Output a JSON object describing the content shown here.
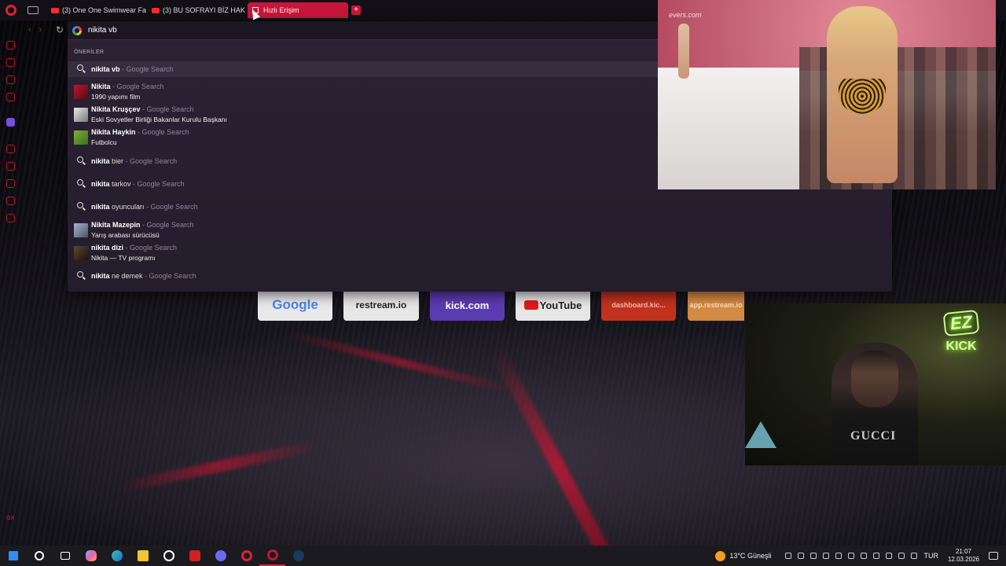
{
  "tabs": [
    {
      "label": "(3) One One Swimwear Fa",
      "type": "youtube"
    },
    {
      "label": "(3) BU SOFRAYI BİZ HAK",
      "type": "youtube"
    },
    {
      "label": "Hızlı Erişim",
      "type": "speed-dial",
      "active": true
    }
  ],
  "address": {
    "value": "nikita vb"
  },
  "suggestions_header": "ÖNERİLER",
  "suggestions": [
    {
      "bold": "nikita vb",
      "rest": "",
      "source": "- Google Search",
      "sub": "",
      "icon": "search-icon"
    },
    {
      "bold": "Nikita",
      "rest": "",
      "source": "- Google Search",
      "sub": "1990 yapımı film",
      "icon": "thumbnail"
    },
    {
      "bold": "Nikita Kruşçev",
      "rest": "",
      "source": "- Google Search",
      "sub": "Eski Sovyetler Birliği Bakanlar Kurulu Başkanı",
      "icon": "thumbnail"
    },
    {
      "bold": "Nikita Haykin",
      "rest": "",
      "source": "- Google Search",
      "sub": "Futbolcu",
      "icon": "thumbnail"
    },
    {
      "bold": "nikita",
      "rest": " bier",
      "source": "- Google Search",
      "sub": "",
      "icon": "search-icon"
    },
    {
      "bold": "nikita",
      "rest": " tarkov",
      "source": "- Google Search",
      "sub": "",
      "icon": "search-icon"
    },
    {
      "bold": "nikita",
      "rest": " oyuncuları",
      "source": "- Google Search",
      "sub": "",
      "icon": "search-icon"
    },
    {
      "bold": "Nikita Mazepin",
      "rest": "",
      "source": "- Google Search",
      "sub": "Yarış arabası sürücüsü",
      "icon": "thumbnail"
    },
    {
      "bold": "nikita dizi",
      "rest": "",
      "source": "- Google Search",
      "sub": "Nikita — TV programı",
      "icon": "thumbnail"
    },
    {
      "bold": "nikita",
      "rest": " ne demek",
      "source": "- Google Search",
      "sub": "",
      "icon": "search-icon"
    }
  ],
  "speed_dial": [
    {
      "label": "Google"
    },
    {
      "label": "restream.io"
    },
    {
      "label": "kick.com"
    },
    {
      "label": "YouTube"
    },
    {
      "label": "dashboard.kic..."
    },
    {
      "label": "app.restream.io"
    }
  ],
  "overlay": {
    "watermark": "evers.com",
    "shirt_text": "GUCCI",
    "neon_top": "EZ",
    "neon_bottom": "KICK"
  },
  "taskbar": {
    "weather": "13°C",
    "weather_desc": "Güneşli",
    "lang": "TUR",
    "time": "21:07",
    "date": "12.03.2026"
  },
  "colors": {
    "accent": "#c8163a",
    "dropdown_bg": "#2b2233",
    "kick": "#5a3bb0"
  }
}
